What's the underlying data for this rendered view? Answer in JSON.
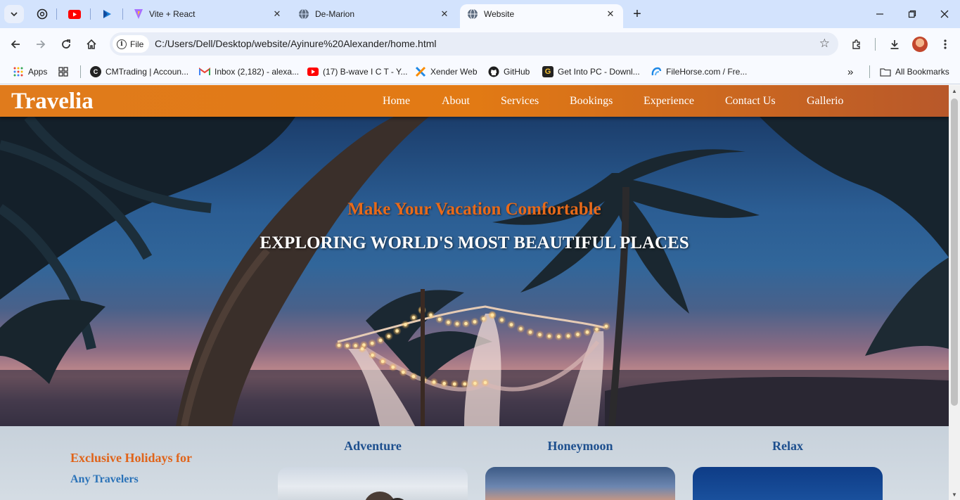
{
  "browser": {
    "tabs": [
      {
        "label": "Vite + React"
      },
      {
        "label": "De-Marion"
      },
      {
        "label": "Website",
        "active": true
      }
    ],
    "new_tab_symbol": "+",
    "url_chip": "File",
    "url": "C:/Users/Dell/Desktop/website/Ayinure%20Alexander/home.html",
    "bookmarks": [
      {
        "label": "Apps",
        "icon": "apps-grid-icon"
      },
      {
        "label": "CMTrading | Accoun...",
        "icon": "cmtrading-icon"
      },
      {
        "label": "Inbox (2,182) - alexa...",
        "icon": "gmail-icon"
      },
      {
        "label": "(17) B-wave I C T - Y...",
        "icon": "youtube-icon"
      },
      {
        "label": "Xender Web",
        "icon": "xender-icon"
      },
      {
        "label": "GitHub",
        "icon": "github-icon"
      },
      {
        "label": "Get Into PC - Downl...",
        "icon": "getintopc-icon"
      },
      {
        "label": "FileHorse.com / Fre...",
        "icon": "filehorse-icon"
      }
    ],
    "more_bookmarks": "»",
    "all_bookmarks": "All Bookmarks"
  },
  "site": {
    "logo": "Travelia",
    "nav": [
      "Home",
      "About",
      "Services",
      "Bookings",
      "Experience",
      "Contact Us",
      "Gallerio"
    ],
    "hero": {
      "subtitle": "Make Your Vacation Comfortable",
      "title": "EXPLORING WORLD'S MOST BEAUTIFUL PLACES"
    },
    "section": {
      "heading": "Exclusive Holidays for",
      "subheading": "Any Travelers"
    },
    "cards": [
      {
        "title": "Adventure"
      },
      {
        "title": "Honeymoon"
      },
      {
        "title": "Relax"
      }
    ]
  },
  "colors": {
    "nav_gradient_start": "#e07b1c",
    "nav_gradient_end": "#b8582a",
    "accent_orange": "#e86a1a",
    "heading_blue": "#1d4f8e"
  }
}
